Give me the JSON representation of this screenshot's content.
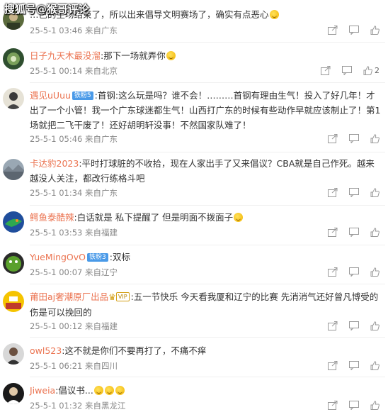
{
  "watermark": "搜狐号@猴哥评论",
  "comments": [
    {
      "user": "",
      "badges": [],
      "text": "…己的主场结束了，所以出来倡导文明赛场了，确实有点恶心",
      "emojis": 1,
      "date": "25-5-1 03:46",
      "location": "来自广东",
      "likes": ""
    },
    {
      "user": "日子九天木最没溜",
      "badges": [],
      "text": ":那下一场就弄你",
      "emojis": 1,
      "date": "25-5-1 00:14",
      "location": "来自北京",
      "likes": "2"
    },
    {
      "user": "遇见uUuu",
      "badges": [
        "铁粉5"
      ],
      "text": ":首钢:这么玩是吗？谁不会！………首钢有理由生气！投入了好几年！才出了一个小管！我一个广东球迷都生气！山西打广东的时候有些动作早就应该制止了！第1场就把二飞干废了！还好胡明轩没事！不然国家队难了！",
      "emojis": 0,
      "date": "25-5-1 05:46",
      "location": "来自广东",
      "likes": ""
    },
    {
      "user": "卡达豹2023",
      "badges": [],
      "text": ":平时打球脏的不收拾，现在人家出手了又来倡议？CBA就是自己作死。越来越没人关注，都改行练格斗吧",
      "emojis": 0,
      "date": "25-5-1 01:34",
      "location": "来自广东",
      "likes": ""
    },
    {
      "user": "鳄鱼泰酷辣",
      "badges": [],
      "text": ":白话就是 私下提醒了 但是明面不拨面子",
      "emojis": 1,
      "date": "25-5-1 03:53",
      "location": "来自福建",
      "likes": ""
    },
    {
      "user": "YueMingOvO",
      "badges": [
        "铁粉3"
      ],
      "text": ":双标",
      "emojis": 0,
      "date": "25-5-1 00:07",
      "location": "来自辽宁",
      "likes": ""
    },
    {
      "user": "莆田aj奢潮原厂出品",
      "badges": [
        "VIP"
      ],
      "text": ":五一节快乐 今天看我厦和辽宁的比赛 先消消气还好曾凡博受的伤是可以挽回的",
      "emojis": 0,
      "date": "25-5-1 00:12",
      "location": "来自福建",
      "likes": ""
    },
    {
      "user": "owl523",
      "badges": [],
      "text": ":这不就是你们不要再打了，不痛不痒",
      "emojis": 0,
      "date": "25-5-1 06:21",
      "location": "来自四川",
      "likes": ""
    },
    {
      "user": "Jiweia",
      "badges": [],
      "text": ":倡议书...",
      "emojis": 3,
      "date": "25-5-1 01:32",
      "location": "来自黑龙江",
      "likes": ""
    }
  ],
  "colors": {
    "username": "#eb7350",
    "meta": "#888888",
    "text": "#333333"
  }
}
